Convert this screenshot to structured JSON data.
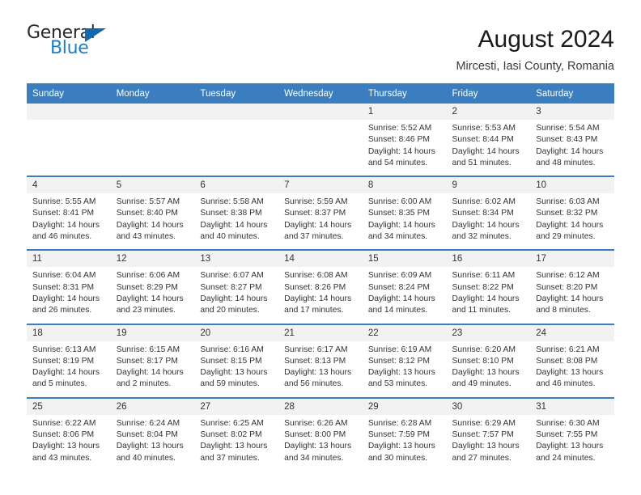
{
  "brand": {
    "name_top": "General",
    "name_bottom": "Blue",
    "triangle_color": "#1567ae",
    "blue_color": "#1f7fc4"
  },
  "header": {
    "title": "August 2024",
    "location": "Mircesti, Iasi County, Romania",
    "header_bg": "#3a7ebf",
    "daynum_bg": "#f2f2f2"
  },
  "weekday_headers": [
    "Sunday",
    "Monday",
    "Tuesday",
    "Wednesday",
    "Thursday",
    "Friday",
    "Saturday"
  ],
  "labels": {
    "sunrise_prefix": "Sunrise:",
    "sunset_prefix": "Sunset:",
    "daylight_prefix": "Daylight:"
  },
  "weeks": [
    [
      {
        "day": "",
        "sunrise": "",
        "sunset": "",
        "daylight_line1": "",
        "daylight_line2": ""
      },
      {
        "day": "",
        "sunrise": "",
        "sunset": "",
        "daylight_line1": "",
        "daylight_line2": ""
      },
      {
        "day": "",
        "sunrise": "",
        "sunset": "",
        "daylight_line1": "",
        "daylight_line2": ""
      },
      {
        "day": "",
        "sunrise": "",
        "sunset": "",
        "daylight_line1": "",
        "daylight_line2": ""
      },
      {
        "day": "1",
        "sunrise": "Sunrise: 5:52 AM",
        "sunset": "Sunset: 8:46 PM",
        "daylight_line1": "Daylight: 14 hours",
        "daylight_line2": "and 54 minutes."
      },
      {
        "day": "2",
        "sunrise": "Sunrise: 5:53 AM",
        "sunset": "Sunset: 8:44 PM",
        "daylight_line1": "Daylight: 14 hours",
        "daylight_line2": "and 51 minutes."
      },
      {
        "day": "3",
        "sunrise": "Sunrise: 5:54 AM",
        "sunset": "Sunset: 8:43 PM",
        "daylight_line1": "Daylight: 14 hours",
        "daylight_line2": "and 48 minutes."
      }
    ],
    [
      {
        "day": "4",
        "sunrise": "Sunrise: 5:55 AM",
        "sunset": "Sunset: 8:41 PM",
        "daylight_line1": "Daylight: 14 hours",
        "daylight_line2": "and 46 minutes."
      },
      {
        "day": "5",
        "sunrise": "Sunrise: 5:57 AM",
        "sunset": "Sunset: 8:40 PM",
        "daylight_line1": "Daylight: 14 hours",
        "daylight_line2": "and 43 minutes."
      },
      {
        "day": "6",
        "sunrise": "Sunrise: 5:58 AM",
        "sunset": "Sunset: 8:38 PM",
        "daylight_line1": "Daylight: 14 hours",
        "daylight_line2": "and 40 minutes."
      },
      {
        "day": "7",
        "sunrise": "Sunrise: 5:59 AM",
        "sunset": "Sunset: 8:37 PM",
        "daylight_line1": "Daylight: 14 hours",
        "daylight_line2": "and 37 minutes."
      },
      {
        "day": "8",
        "sunrise": "Sunrise: 6:00 AM",
        "sunset": "Sunset: 8:35 PM",
        "daylight_line1": "Daylight: 14 hours",
        "daylight_line2": "and 34 minutes."
      },
      {
        "day": "9",
        "sunrise": "Sunrise: 6:02 AM",
        "sunset": "Sunset: 8:34 PM",
        "daylight_line1": "Daylight: 14 hours",
        "daylight_line2": "and 32 minutes."
      },
      {
        "day": "10",
        "sunrise": "Sunrise: 6:03 AM",
        "sunset": "Sunset: 8:32 PM",
        "daylight_line1": "Daylight: 14 hours",
        "daylight_line2": "and 29 minutes."
      }
    ],
    [
      {
        "day": "11",
        "sunrise": "Sunrise: 6:04 AM",
        "sunset": "Sunset: 8:31 PM",
        "daylight_line1": "Daylight: 14 hours",
        "daylight_line2": "and 26 minutes."
      },
      {
        "day": "12",
        "sunrise": "Sunrise: 6:06 AM",
        "sunset": "Sunset: 8:29 PM",
        "daylight_line1": "Daylight: 14 hours",
        "daylight_line2": "and 23 minutes."
      },
      {
        "day": "13",
        "sunrise": "Sunrise: 6:07 AM",
        "sunset": "Sunset: 8:27 PM",
        "daylight_line1": "Daylight: 14 hours",
        "daylight_line2": "and 20 minutes."
      },
      {
        "day": "14",
        "sunrise": "Sunrise: 6:08 AM",
        "sunset": "Sunset: 8:26 PM",
        "daylight_line1": "Daylight: 14 hours",
        "daylight_line2": "and 17 minutes."
      },
      {
        "day": "15",
        "sunrise": "Sunrise: 6:09 AM",
        "sunset": "Sunset: 8:24 PM",
        "daylight_line1": "Daylight: 14 hours",
        "daylight_line2": "and 14 minutes."
      },
      {
        "day": "16",
        "sunrise": "Sunrise: 6:11 AM",
        "sunset": "Sunset: 8:22 PM",
        "daylight_line1": "Daylight: 14 hours",
        "daylight_line2": "and 11 minutes."
      },
      {
        "day": "17",
        "sunrise": "Sunrise: 6:12 AM",
        "sunset": "Sunset: 8:20 PM",
        "daylight_line1": "Daylight: 14 hours",
        "daylight_line2": "and 8 minutes."
      }
    ],
    [
      {
        "day": "18",
        "sunrise": "Sunrise: 6:13 AM",
        "sunset": "Sunset: 8:19 PM",
        "daylight_line1": "Daylight: 14 hours",
        "daylight_line2": "and 5 minutes."
      },
      {
        "day": "19",
        "sunrise": "Sunrise: 6:15 AM",
        "sunset": "Sunset: 8:17 PM",
        "daylight_line1": "Daylight: 14 hours",
        "daylight_line2": "and 2 minutes."
      },
      {
        "day": "20",
        "sunrise": "Sunrise: 6:16 AM",
        "sunset": "Sunset: 8:15 PM",
        "daylight_line1": "Daylight: 13 hours",
        "daylight_line2": "and 59 minutes."
      },
      {
        "day": "21",
        "sunrise": "Sunrise: 6:17 AM",
        "sunset": "Sunset: 8:13 PM",
        "daylight_line1": "Daylight: 13 hours",
        "daylight_line2": "and 56 minutes."
      },
      {
        "day": "22",
        "sunrise": "Sunrise: 6:19 AM",
        "sunset": "Sunset: 8:12 PM",
        "daylight_line1": "Daylight: 13 hours",
        "daylight_line2": "and 53 minutes."
      },
      {
        "day": "23",
        "sunrise": "Sunrise: 6:20 AM",
        "sunset": "Sunset: 8:10 PM",
        "daylight_line1": "Daylight: 13 hours",
        "daylight_line2": "and 49 minutes."
      },
      {
        "day": "24",
        "sunrise": "Sunrise: 6:21 AM",
        "sunset": "Sunset: 8:08 PM",
        "daylight_line1": "Daylight: 13 hours",
        "daylight_line2": "and 46 minutes."
      }
    ],
    [
      {
        "day": "25",
        "sunrise": "Sunrise: 6:22 AM",
        "sunset": "Sunset: 8:06 PM",
        "daylight_line1": "Daylight: 13 hours",
        "daylight_line2": "and 43 minutes."
      },
      {
        "day": "26",
        "sunrise": "Sunrise: 6:24 AM",
        "sunset": "Sunset: 8:04 PM",
        "daylight_line1": "Daylight: 13 hours",
        "daylight_line2": "and 40 minutes."
      },
      {
        "day": "27",
        "sunrise": "Sunrise: 6:25 AM",
        "sunset": "Sunset: 8:02 PM",
        "daylight_line1": "Daylight: 13 hours",
        "daylight_line2": "and 37 minutes."
      },
      {
        "day": "28",
        "sunrise": "Sunrise: 6:26 AM",
        "sunset": "Sunset: 8:00 PM",
        "daylight_line1": "Daylight: 13 hours",
        "daylight_line2": "and 34 minutes."
      },
      {
        "day": "29",
        "sunrise": "Sunrise: 6:28 AM",
        "sunset": "Sunset: 7:59 PM",
        "daylight_line1": "Daylight: 13 hours",
        "daylight_line2": "and 30 minutes."
      },
      {
        "day": "30",
        "sunrise": "Sunrise: 6:29 AM",
        "sunset": "Sunset: 7:57 PM",
        "daylight_line1": "Daylight: 13 hours",
        "daylight_line2": "and 27 minutes."
      },
      {
        "day": "31",
        "sunrise": "Sunrise: 6:30 AM",
        "sunset": "Sunset: 7:55 PM",
        "daylight_line1": "Daylight: 13 hours",
        "daylight_line2": "and 24 minutes."
      }
    ]
  ]
}
